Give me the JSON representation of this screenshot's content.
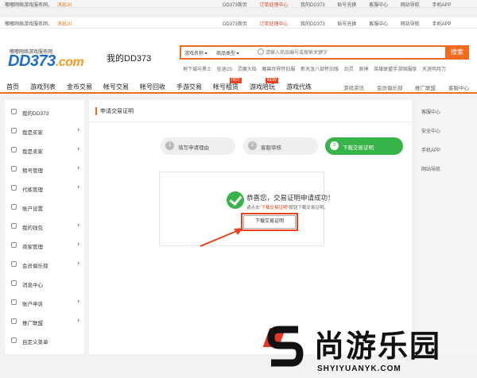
{
  "topbar": {
    "welcome": "嘟嘟网络游戏服务网，",
    "message": "消息20",
    "links": [
      "DD373首页",
      "订单处理中心",
      "我的DD373",
      "贴号充换",
      "客服中心",
      "网站导航",
      "手机APP"
    ]
  },
  "header": {
    "logo_sub": "嘟嘟网络游戏服务网",
    "logo_main": "DD373",
    "logo_com": ".com",
    "page_title": "我的DD373",
    "search": {
      "game_select": "游戏名称",
      "type_select": "商品类型",
      "placeholder": "请输入商品编号或搜索关键字",
      "button": "搜索"
    },
    "hotwords": [
      "地下城与勇士",
      "征途2S",
      "灵魔大陆",
      "魔兽世界怀旧服",
      "新天龙八部怀旧版",
      "剑灵",
      "原神",
      "英雄联盟手游国服版",
      "天涯明月刀"
    ]
  },
  "nav": {
    "items": [
      "首页",
      "游戏列表",
      "金币交易",
      "帐号交易",
      "帐号回收",
      "手游交易",
      "帐号租赁",
      "游戏陪玩",
      "游戏代练"
    ],
    "tags": {
      "rent": "HOT",
      "play": "NEW"
    },
    "right_items": [
      "游戏资讯",
      "会员俱乐部",
      "推广联盟",
      "客服中心"
    ]
  },
  "sidebar": {
    "items": [
      {
        "label": "我的DD373",
        "arrow": ""
      },
      {
        "label": "我是买家",
        "arrow": "▾"
      },
      {
        "label": "我是卖家",
        "arrow": "▾"
      },
      {
        "label": "租号管理",
        "arrow": "▾"
      },
      {
        "label": "代练管理",
        "arrow": "▾"
      },
      {
        "label": "账户设置",
        "arrow": ""
      },
      {
        "label": "我的钱包",
        "arrow": "▾"
      },
      {
        "label": "商家管理",
        "arrow": "▾"
      },
      {
        "label": "会员俱乐部",
        "arrow": "▾"
      },
      {
        "label": "消息中心",
        "arrow": ""
      },
      {
        "label": "账户申诉",
        "arrow": "▾"
      },
      {
        "label": "推广联盟",
        "arrow": "▾"
      },
      {
        "label": "自定义菜单",
        "arrow": ""
      }
    ]
  },
  "main": {
    "title": "申请交易证明",
    "steps": [
      {
        "num": "1",
        "label": "填写申请理由"
      },
      {
        "num": "2",
        "label": "客服审核"
      },
      {
        "num": "3",
        "label": "下载交易证明"
      }
    ],
    "success_title": "恭喜您，交易证明申请成功！",
    "success_sub_pre": "请点击",
    "success_sub_em": "\"下载交易证明\"",
    "success_sub_post": "按钮下载交易证明。",
    "download_button": "下载交易证明"
  },
  "right_panel": {
    "items": [
      "客服中心",
      "安全中心",
      "手机APP",
      "网站导航"
    ]
  },
  "watermark": {
    "cn": "尚游乐园",
    "en": "SHYIYUANYK.COM"
  },
  "colors": {
    "accent": "#f36b1f",
    "success": "#37b449",
    "brand_blue": "#1e6fc8",
    "alert_red": "#e8431f"
  }
}
